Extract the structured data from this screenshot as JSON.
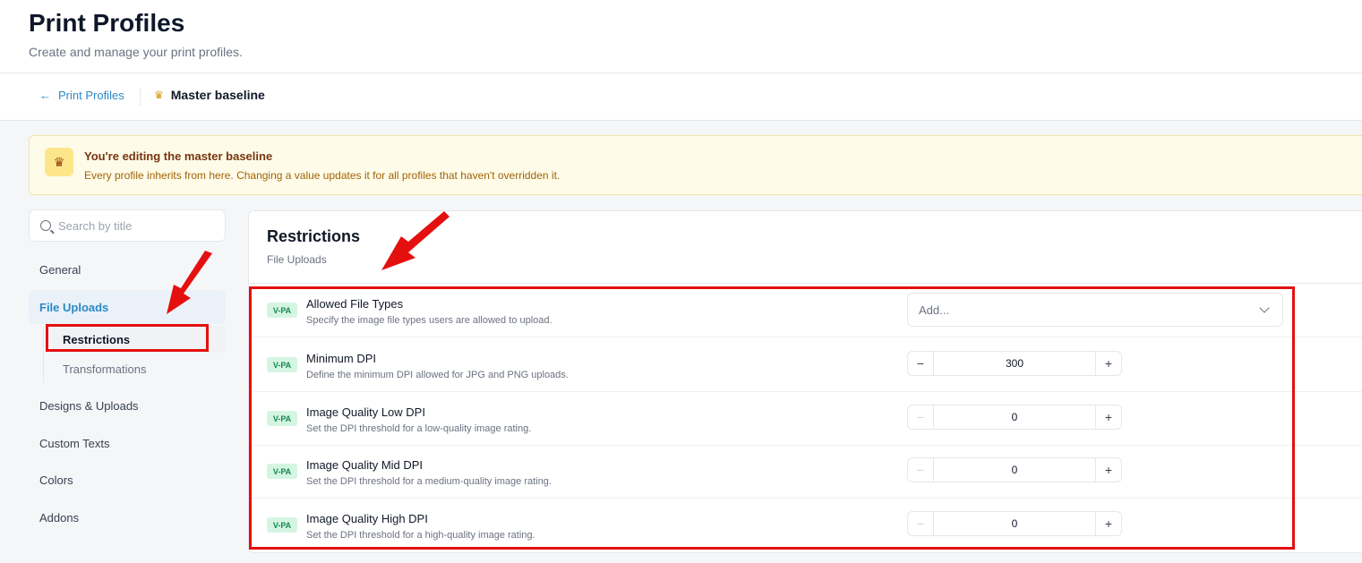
{
  "header": {
    "title": "Print Profiles",
    "subtitle": "Create and manage your print profiles."
  },
  "breadcrumb": {
    "back_label": "Print Profiles",
    "current_label": "Master baseline"
  },
  "banner": {
    "title": "You're editing the master baseline",
    "text": "Every profile inherits from here. Changing a value updates it for all profiles that haven't overridden it."
  },
  "search": {
    "placeholder": "Search by title"
  },
  "sidebar": {
    "items": [
      {
        "label": "General"
      },
      {
        "label": "File Uploads",
        "active": true
      },
      {
        "label": "Designs & Uploads"
      },
      {
        "label": "Custom Texts"
      },
      {
        "label": "Colors"
      },
      {
        "label": "Addons"
      }
    ],
    "subitems": [
      {
        "label": "Restrictions",
        "active": true
      },
      {
        "label": "Transformations"
      }
    ]
  },
  "panel": {
    "title": "Restrictions",
    "subtitle": "File Uploads"
  },
  "settings": [
    {
      "badge": "V-PA",
      "label": "Allowed File Types",
      "description": "Specify the image file types users are allowed to upload.",
      "control": "select",
      "placeholder": "Add..."
    },
    {
      "badge": "V-PA",
      "label": "Minimum DPI",
      "description": "Define the minimum DPI allowed for JPG and PNG uploads.",
      "control": "stepper",
      "value": "300"
    },
    {
      "badge": "V-PA",
      "label": "Image Quality Low DPI",
      "description": "Set the DPI threshold for a low-quality image rating.",
      "control": "stepper",
      "value": "0"
    },
    {
      "badge": "V-PA",
      "label": "Image Quality Mid DPI",
      "description": "Set the DPI threshold for a medium-quality image rating.",
      "control": "stepper",
      "value": "0"
    },
    {
      "badge": "V-PA",
      "label": "Image Quality High DPI",
      "description": "Set the DPI threshold for a high-quality image rating.",
      "control": "stepper",
      "value": "0"
    }
  ],
  "stepper_symbols": {
    "minus": "−",
    "plus": "+"
  },
  "icons": {
    "back": "arrow-left-icon",
    "crown": "crown-icon",
    "search": "search-icon",
    "chevron": "chevron-down-icon"
  },
  "colors": {
    "accent": "#2b8ac7",
    "annotation": "#e41010",
    "badge_bg": "#d5f5e3",
    "badge_text": "#138a4f",
    "banner_bg": "#fefce8"
  }
}
